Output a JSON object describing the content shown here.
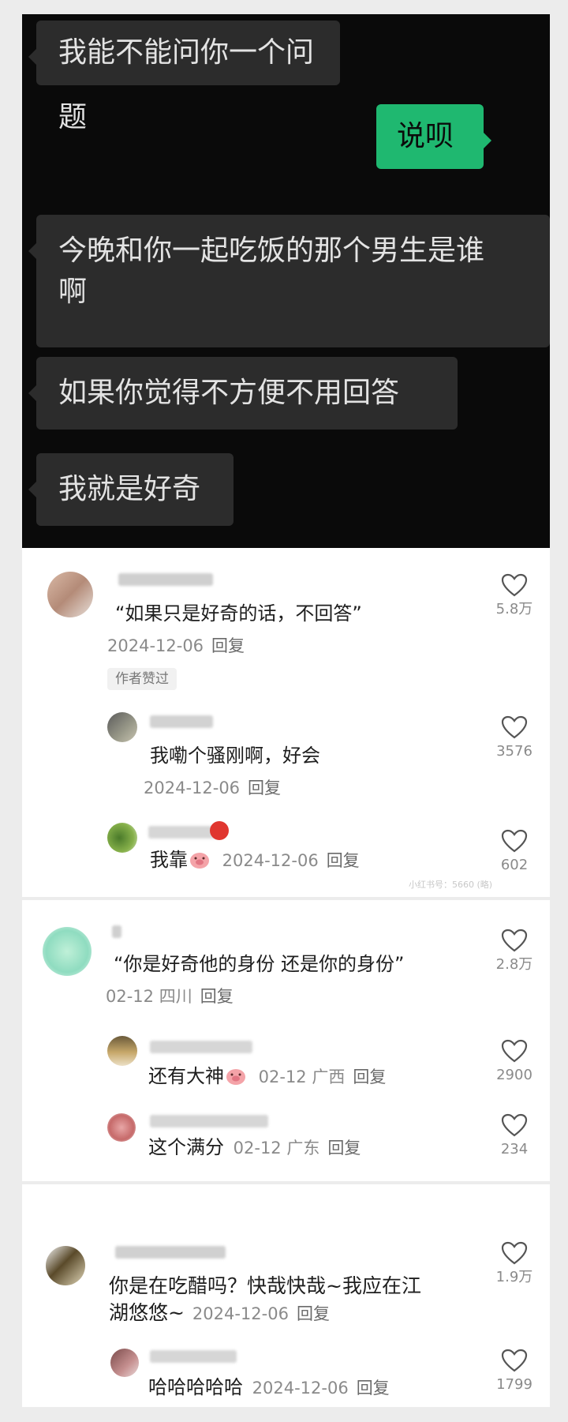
{
  "chat": {
    "messages": [
      {
        "side": "left",
        "text": "我能不能问你一个问题"
      },
      {
        "side": "right",
        "text": "说呗"
      },
      {
        "side": "left",
        "text": "今晚和你一起吃饭的那个男生是谁"
      },
      {
        "side": "left",
        "text": "啊"
      },
      {
        "side": "left",
        "text": "如果你觉得不方便不用回答"
      },
      {
        "side": "left",
        "text": "我就是好奇"
      }
    ]
  },
  "panel1": {
    "top": {
      "text": "“如果只是好奇的话，不回答”",
      "meta": "2024-12-06",
      "reply": "回复",
      "likes": "5.8万",
      "tag": "作者赞过"
    },
    "replies": [
      {
        "text": "我嘞个骚刚啊，好会",
        "meta": "2024-12-06",
        "reply": "回复",
        "likes": "3576"
      },
      {
        "text": "我靠",
        "meta": "2024-12-06",
        "reply": "回复",
        "likes": "602"
      }
    ],
    "watermark": "小红书号：5660 (略)"
  },
  "panel2": {
    "top": {
      "text": "“你是好奇他的身份 还是你的身份”",
      "meta": "02-12 四川",
      "reply": "回复",
      "likes": "2.8万"
    },
    "replies": [
      {
        "text": "还有大神",
        "meta": "02-12 广西",
        "reply": "回复",
        "likes": "2900"
      },
      {
        "text": "这个满分",
        "meta": "02-12 广东",
        "reply": "回复",
        "likes": "234"
      }
    ]
  },
  "panel3": {
    "top": {
      "line1": "你是在吃醋吗？快哉快哉~我应在江",
      "line2": "湖悠悠~",
      "meta": "2024-12-06",
      "reply": "回复",
      "likes": "1.9万"
    },
    "replies": [
      {
        "text": "哈哈哈哈哈",
        "meta": "2024-12-06",
        "reply": "回复",
        "likes": "1799"
      }
    ]
  },
  "icons": {
    "like": "heart-outline-icon",
    "emoji": "pig-face-emoji-icon"
  },
  "colors": {
    "chat_bg": "#0a0a0a",
    "bubble_left": "#2c2c2c",
    "bubble_right": "#1fb870",
    "page_bg": "#ececec"
  }
}
